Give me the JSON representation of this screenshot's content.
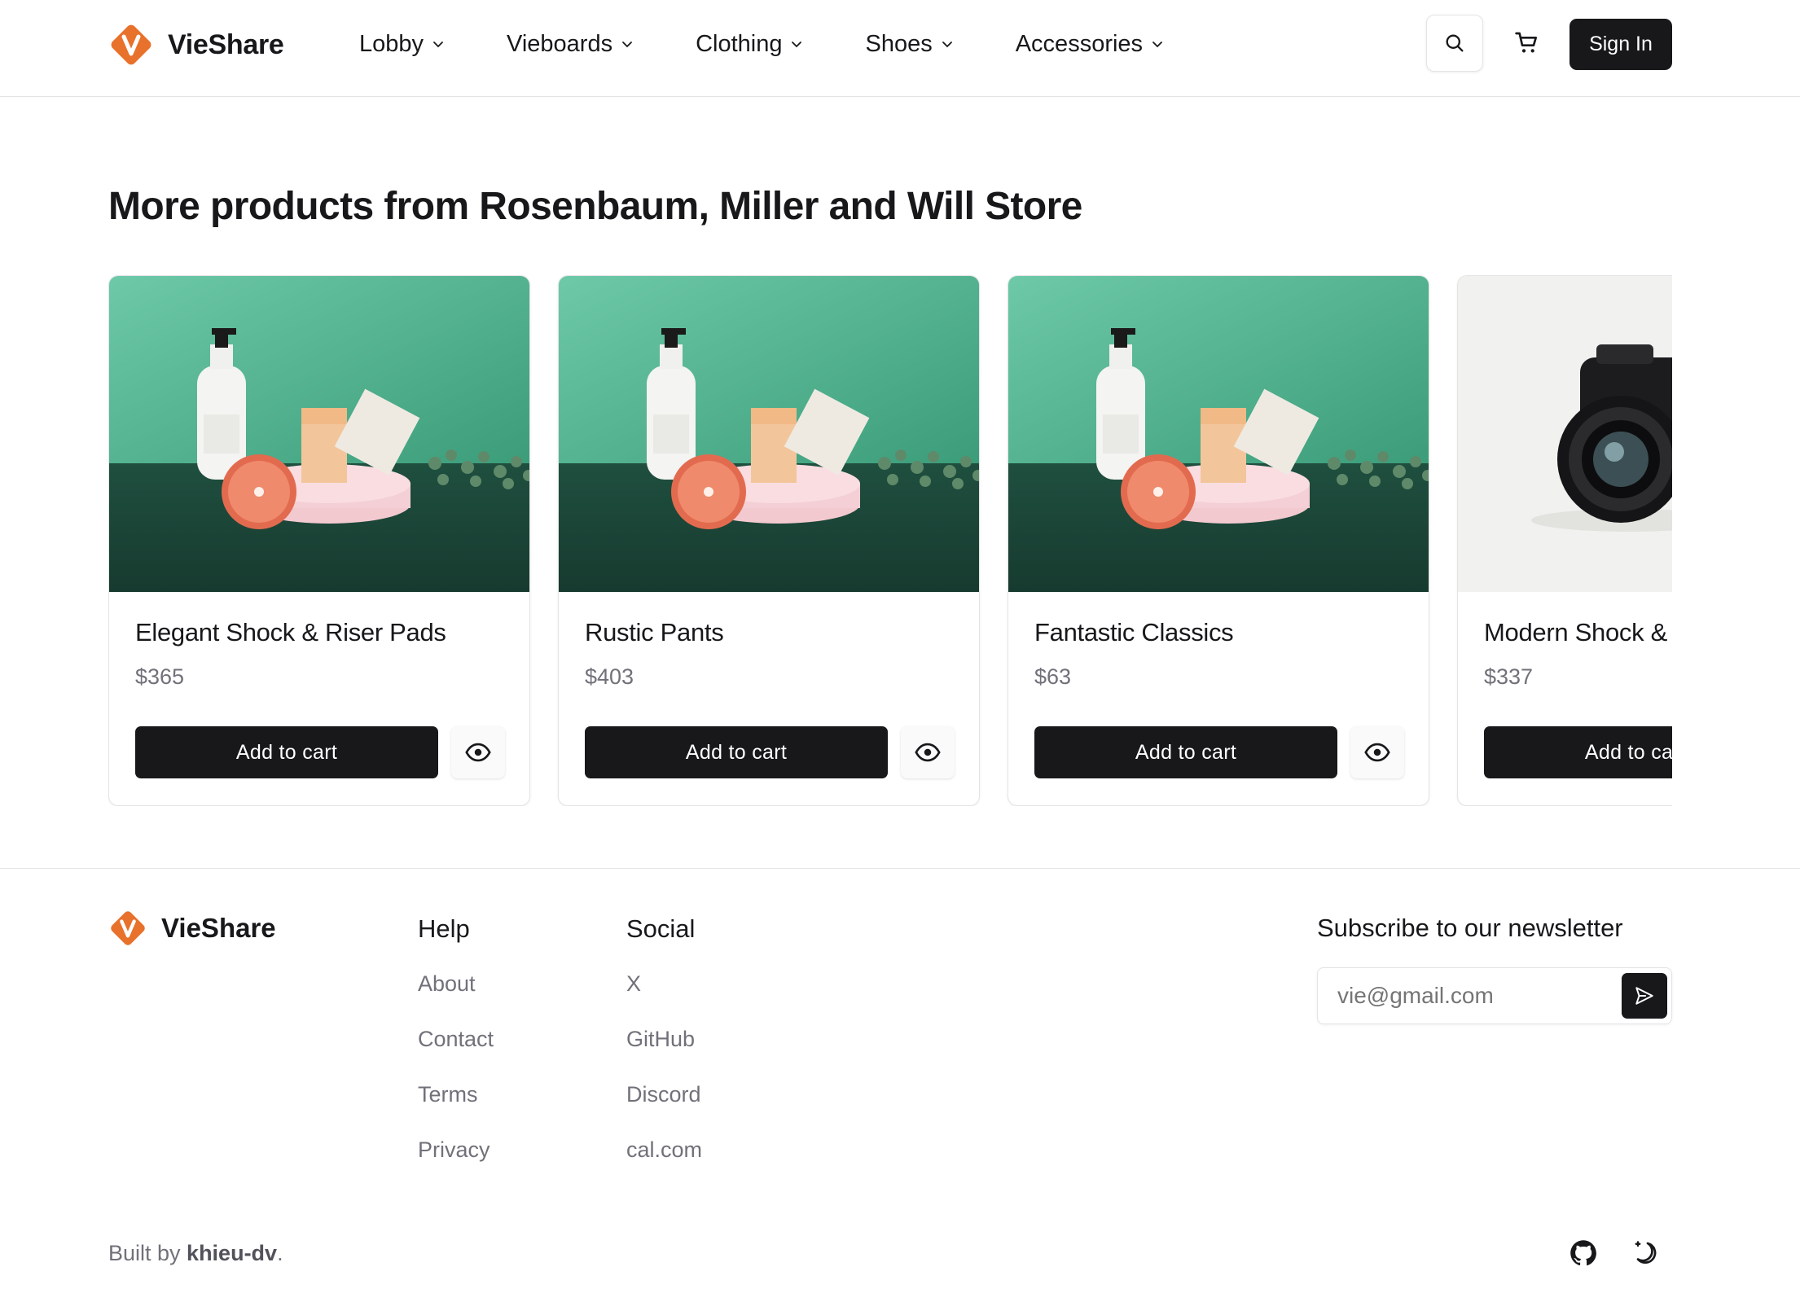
{
  "app": {
    "brand": "VieShare"
  },
  "header": {
    "nav": [
      {
        "label": "Lobby"
      },
      {
        "label": "Vieboards"
      },
      {
        "label": "Clothing"
      },
      {
        "label": "Shoes"
      },
      {
        "label": "Accessories"
      }
    ],
    "search_icon": "search-icon",
    "cart_icon": "cart-icon",
    "signin_label": "Sign In"
  },
  "main": {
    "title": "More products from Rosenbaum, Miller and Will Store",
    "products": [
      {
        "name": "Elegant Shock & Riser Pads",
        "price": "$365",
        "add_label": "Add to cart",
        "image": "skincare-products-photo"
      },
      {
        "name": "Rustic Pants",
        "price": "$403",
        "add_label": "Add to cart",
        "image": "skincare-products-photo"
      },
      {
        "name": "Fantastic Classics",
        "price": "$63",
        "add_label": "Add to cart",
        "image": "skincare-products-photo"
      },
      {
        "name": "Modern Shock & Riser Pads",
        "price": "$337",
        "add_label": "Add to cart",
        "image": "camera-photo"
      }
    ]
  },
  "footer": {
    "brand": "VieShare",
    "help": {
      "heading": "Help",
      "links": [
        "About",
        "Contact",
        "Terms",
        "Privacy"
      ]
    },
    "social": {
      "heading": "Social",
      "links": [
        "X",
        "GitHub",
        "Discord",
        "cal.com"
      ]
    },
    "newsletter": {
      "heading": "Subscribe to our newsletter",
      "placeholder": "vie@gmail.com"
    },
    "built_by_prefix": "Built by ",
    "built_by_name": "khieu-dv",
    "built_by_suffix": "."
  },
  "colors": {
    "primary": "#18181b",
    "muted": "#71717a",
    "brand": "#e8712b",
    "border": "#e4e4e7"
  }
}
